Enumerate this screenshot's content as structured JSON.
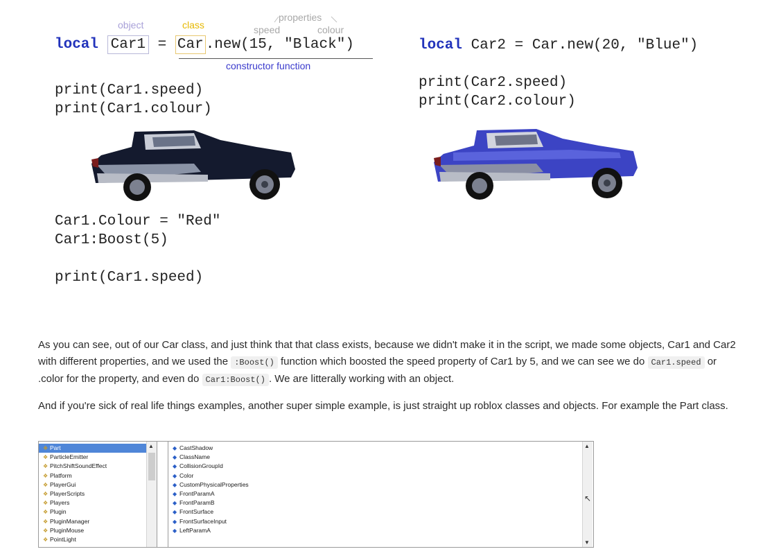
{
  "diagram": {
    "annotations": {
      "object": "object",
      "class": "class",
      "properties": "properties",
      "speed": "speed",
      "colour": "colour",
      "constructor": "constructor function"
    },
    "code_left": {
      "kw": "local",
      "var": "Car1",
      "eq": "=",
      "cls": "Car",
      "rest": ".new(15, \"Black\")",
      "print1": "print(Car1.speed)",
      "print2": "print(Car1.colour)",
      "set": "Car1.Colour = \"Red\"",
      "boost": "Car1:Boost(5)",
      "print3": "print(Car1.speed)"
    },
    "code_right": {
      "kw": "local",
      "rest": "Car2 = Car.new(20, \"Blue\")",
      "print1": "print(Car2.speed)",
      "print2": "print(Car2.colour)"
    },
    "colors": {
      "car_black": "#141a2e",
      "car_blue": "#3c44c4",
      "keyword": "#2233bb"
    }
  },
  "article": {
    "p1_a": "As you can see, out of our Car class, and just think that that class exists, because we didn't make it in the script, we made some objects, Car1 and Car2 with different properties, and we used the ",
    "p1_code1": ":Boost()",
    "p1_b": " function which boosted the speed property of Car1 by 5, and we can see we do ",
    "p1_code2": "Car1.speed",
    "p1_c": " or .color for the property, and even do ",
    "p1_code3": "Car1:Boost()",
    "p1_d": ". We are litterally working with an object.",
    "p2": "And if you're sick of real life things examples, another super simple example, is just straight up roblox classes and objects. For example the Part class."
  },
  "explorer": {
    "classes": [
      "Part",
      "ParticleEmitter",
      "PitchShiftSoundEffect",
      "Platform",
      "PlayerGui",
      "PlayerScripts",
      "Players",
      "Plugin",
      "PluginManager",
      "PluginMouse",
      "PointLight"
    ],
    "properties": [
      "CastShadow",
      "ClassName",
      "CollisionGroupId",
      "Color",
      "CustomPhysicalProperties",
      "FrontParamA",
      "FrontParamB",
      "FrontSurface",
      "FrontSurfaceInput",
      "LeftParamA"
    ]
  }
}
